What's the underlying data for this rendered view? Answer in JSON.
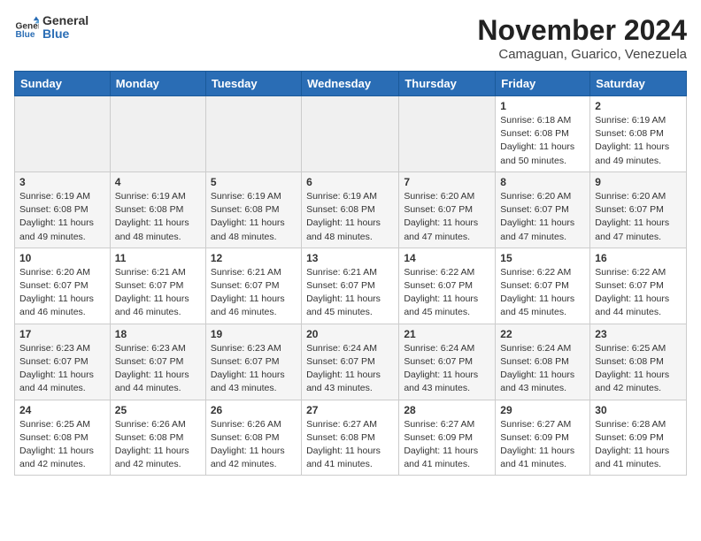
{
  "header": {
    "logo_general": "General",
    "logo_blue": "Blue",
    "month_title": "November 2024",
    "location": "Camaguan, Guarico, Venezuela"
  },
  "days_of_week": [
    "Sunday",
    "Monday",
    "Tuesday",
    "Wednesday",
    "Thursday",
    "Friday",
    "Saturday"
  ],
  "weeks": [
    [
      {
        "day": "",
        "empty": true
      },
      {
        "day": "",
        "empty": true
      },
      {
        "day": "",
        "empty": true
      },
      {
        "day": "",
        "empty": true
      },
      {
        "day": "",
        "empty": true
      },
      {
        "day": "1",
        "sunrise": "6:18 AM",
        "sunset": "6:08 PM",
        "daylight": "11 hours and 50 minutes."
      },
      {
        "day": "2",
        "sunrise": "6:19 AM",
        "sunset": "6:08 PM",
        "daylight": "11 hours and 49 minutes."
      }
    ],
    [
      {
        "day": "3",
        "sunrise": "6:19 AM",
        "sunset": "6:08 PM",
        "daylight": "11 hours and 49 minutes."
      },
      {
        "day": "4",
        "sunrise": "6:19 AM",
        "sunset": "6:08 PM",
        "daylight": "11 hours and 48 minutes."
      },
      {
        "day": "5",
        "sunrise": "6:19 AM",
        "sunset": "6:08 PM",
        "daylight": "11 hours and 48 minutes."
      },
      {
        "day": "6",
        "sunrise": "6:19 AM",
        "sunset": "6:08 PM",
        "daylight": "11 hours and 48 minutes."
      },
      {
        "day": "7",
        "sunrise": "6:20 AM",
        "sunset": "6:07 PM",
        "daylight": "11 hours and 47 minutes."
      },
      {
        "day": "8",
        "sunrise": "6:20 AM",
        "sunset": "6:07 PM",
        "daylight": "11 hours and 47 minutes."
      },
      {
        "day": "9",
        "sunrise": "6:20 AM",
        "sunset": "6:07 PM",
        "daylight": "11 hours and 47 minutes."
      }
    ],
    [
      {
        "day": "10",
        "sunrise": "6:20 AM",
        "sunset": "6:07 PM",
        "daylight": "11 hours and 46 minutes."
      },
      {
        "day": "11",
        "sunrise": "6:21 AM",
        "sunset": "6:07 PM",
        "daylight": "11 hours and 46 minutes."
      },
      {
        "day": "12",
        "sunrise": "6:21 AM",
        "sunset": "6:07 PM",
        "daylight": "11 hours and 46 minutes."
      },
      {
        "day": "13",
        "sunrise": "6:21 AM",
        "sunset": "6:07 PM",
        "daylight": "11 hours and 45 minutes."
      },
      {
        "day": "14",
        "sunrise": "6:22 AM",
        "sunset": "6:07 PM",
        "daylight": "11 hours and 45 minutes."
      },
      {
        "day": "15",
        "sunrise": "6:22 AM",
        "sunset": "6:07 PM",
        "daylight": "11 hours and 45 minutes."
      },
      {
        "day": "16",
        "sunrise": "6:22 AM",
        "sunset": "6:07 PM",
        "daylight": "11 hours and 44 minutes."
      }
    ],
    [
      {
        "day": "17",
        "sunrise": "6:23 AM",
        "sunset": "6:07 PM",
        "daylight": "11 hours and 44 minutes."
      },
      {
        "day": "18",
        "sunrise": "6:23 AM",
        "sunset": "6:07 PM",
        "daylight": "11 hours and 44 minutes."
      },
      {
        "day": "19",
        "sunrise": "6:23 AM",
        "sunset": "6:07 PM",
        "daylight": "11 hours and 43 minutes."
      },
      {
        "day": "20",
        "sunrise": "6:24 AM",
        "sunset": "6:07 PM",
        "daylight": "11 hours and 43 minutes."
      },
      {
        "day": "21",
        "sunrise": "6:24 AM",
        "sunset": "6:07 PM",
        "daylight": "11 hours and 43 minutes."
      },
      {
        "day": "22",
        "sunrise": "6:24 AM",
        "sunset": "6:08 PM",
        "daylight": "11 hours and 43 minutes."
      },
      {
        "day": "23",
        "sunrise": "6:25 AM",
        "sunset": "6:08 PM",
        "daylight": "11 hours and 42 minutes."
      }
    ],
    [
      {
        "day": "24",
        "sunrise": "6:25 AM",
        "sunset": "6:08 PM",
        "daylight": "11 hours and 42 minutes."
      },
      {
        "day": "25",
        "sunrise": "6:26 AM",
        "sunset": "6:08 PM",
        "daylight": "11 hours and 42 minutes."
      },
      {
        "day": "26",
        "sunrise": "6:26 AM",
        "sunset": "6:08 PM",
        "daylight": "11 hours and 42 minutes."
      },
      {
        "day": "27",
        "sunrise": "6:27 AM",
        "sunset": "6:08 PM",
        "daylight": "11 hours and 41 minutes."
      },
      {
        "day": "28",
        "sunrise": "6:27 AM",
        "sunset": "6:09 PM",
        "daylight": "11 hours and 41 minutes."
      },
      {
        "day": "29",
        "sunrise": "6:27 AM",
        "sunset": "6:09 PM",
        "daylight": "11 hours and 41 minutes."
      },
      {
        "day": "30",
        "sunrise": "6:28 AM",
        "sunset": "6:09 PM",
        "daylight": "11 hours and 41 minutes."
      }
    ]
  ],
  "labels": {
    "sunrise": "Sunrise:",
    "sunset": "Sunset:",
    "daylight": "Daylight:"
  }
}
